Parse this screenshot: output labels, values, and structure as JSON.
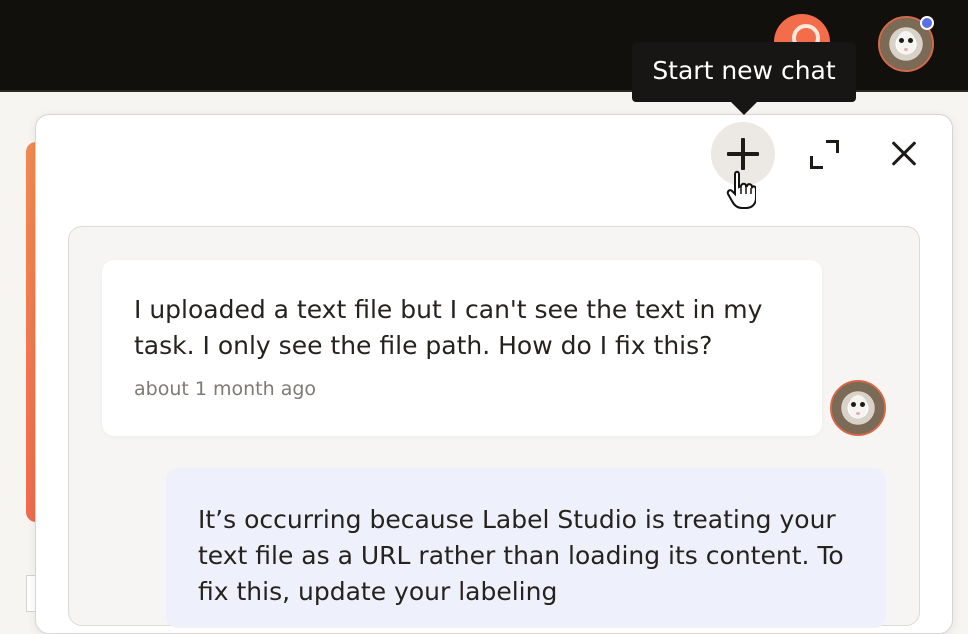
{
  "tooltip": {
    "text": "Start new chat"
  },
  "toolbar": {
    "new_chat_icon": "plus-icon",
    "expand_icon": "expand-icon",
    "close_icon": "close-icon"
  },
  "header": {
    "help_icon": "help-icon",
    "avatar_icon": "avatar-icon",
    "notification_dot_color": "#5b6fe8"
  },
  "conversation": {
    "messages": [
      {
        "role": "user",
        "text": "I uploaded a text file but I can't see the text in my task. I only see the file path. How do I fix this?",
        "time": "about 1 month ago"
      },
      {
        "role": "assistant",
        "text": "It’s occurring because Label Studio is treating your text file as a URL rather than loading its content. To fix this, update your labeling"
      }
    ]
  },
  "colors": {
    "topbar": "#12100d",
    "accent": "#f36d4a",
    "assistant_bubble": "#eef0fb"
  }
}
